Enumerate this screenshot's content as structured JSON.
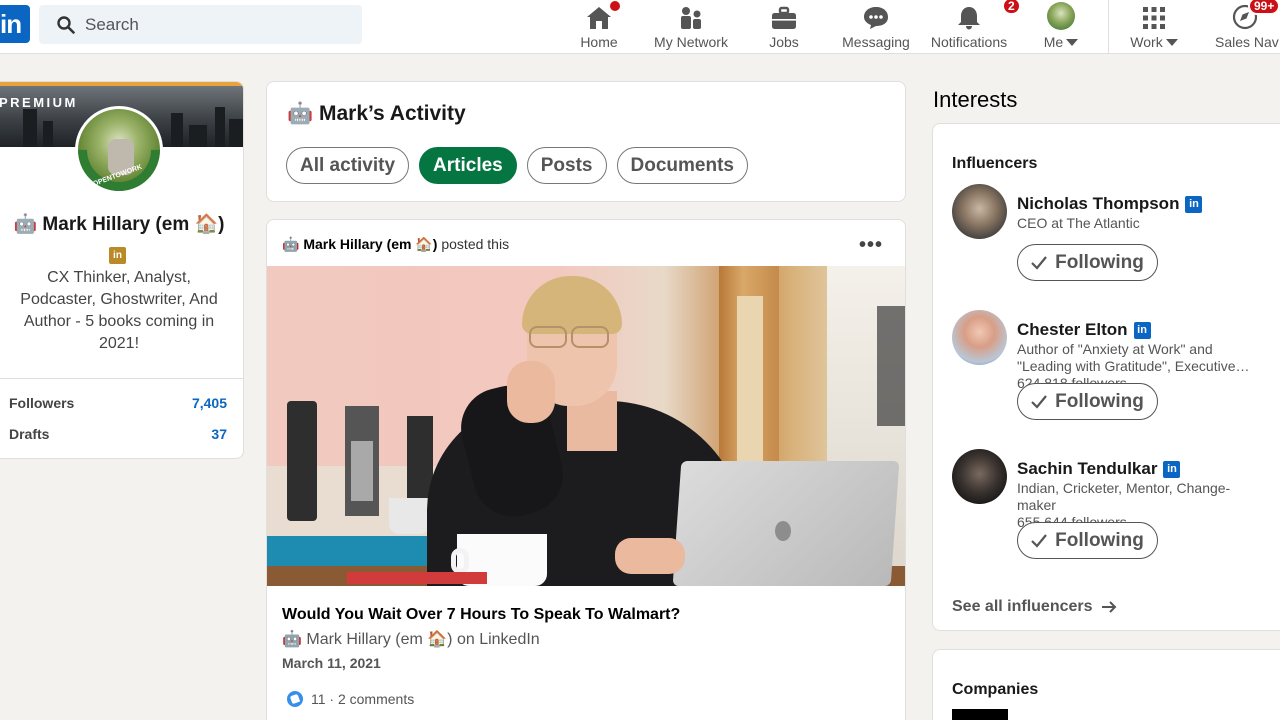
{
  "nav": {
    "search_placeholder": "Search",
    "home": "Home",
    "my_network": "My Network",
    "jobs": "Jobs",
    "messaging": "Messaging",
    "notifications": "Notifications",
    "notifications_count": "2",
    "me": "Me",
    "work": "Work",
    "sales_nav": "Sales Nav",
    "sales_nav_count": "99+"
  },
  "profile": {
    "premium": "PREMIUM",
    "avatar_text": "#OPENTOWORK",
    "name": "🤖 Mark Hillary (em 🏠)",
    "headline": "CX Thinker, Analyst, Podcaster, Ghostwriter, And Author - 5 books coming in 2021!",
    "stats": [
      {
        "label": "Followers",
        "value": "7,405"
      },
      {
        "label": "Drafts",
        "value": "37"
      }
    ]
  },
  "activity": {
    "title": "🤖 Mark’s Activity",
    "filters": [
      "All activity",
      "Articles",
      "Posts",
      "Documents"
    ],
    "active_filter": "Articles"
  },
  "post": {
    "author": "🤖 Mark Hillary (em 🏠)",
    "action": " posted this",
    "title": "Would You Wait Over 7 Hours To Speak To Walmart?",
    "byline": "🤖 Mark Hillary (em 🏠) on LinkedIn",
    "date": "March 11, 2021",
    "reactions": "11 · 2 comments"
  },
  "interests": {
    "title": "Interests",
    "tab": "Influencers",
    "influencers": [
      {
        "name": "Nicholas Thompson",
        "desc": "CEO at The Atlantic",
        "followers": "",
        "button": "Following"
      },
      {
        "name": "Chester Elton",
        "desc": "Author of \"Anxiety at Work\" and \"Leading with Gratitude\", Executive…",
        "followers": "624,818 followers",
        "button": "Following"
      },
      {
        "name": "Sachin Tendulkar",
        "desc": "Indian, Cricketer, Mentor, Change-maker",
        "followers": "655,644 followers",
        "button": "Following"
      }
    ],
    "see_all": "See all influencers",
    "companies_title": "Companies"
  },
  "colors": {
    "brand": "#0a66c2",
    "active_pill": "#057642",
    "badge": "#cc1016",
    "premium_gold": "#e7a33e"
  }
}
